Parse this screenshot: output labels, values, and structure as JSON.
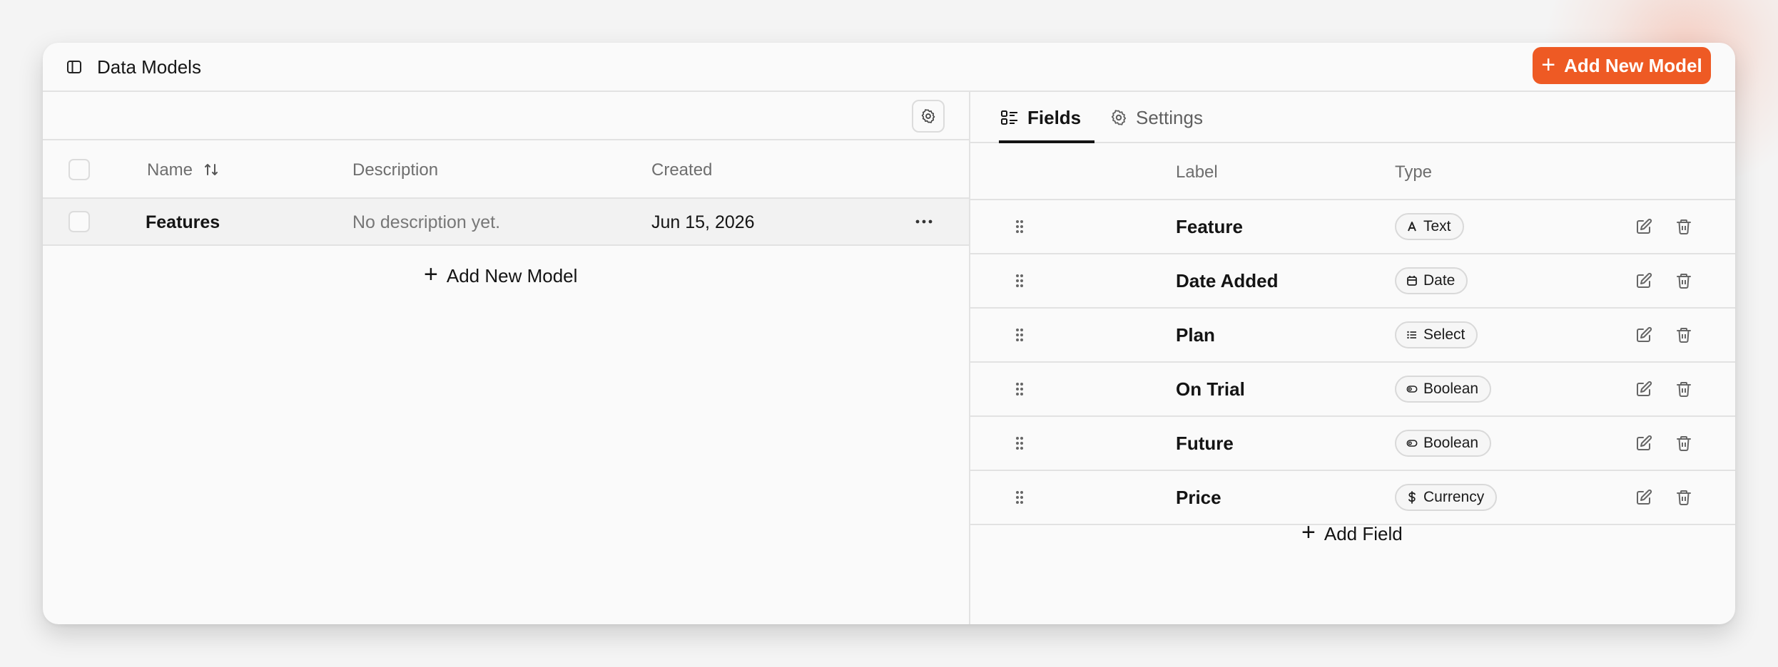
{
  "header": {
    "title": "Data Models",
    "add_button_label": "Add New Model",
    "accent_color": "#ee5a24"
  },
  "models_table": {
    "columns": {
      "name": "Name",
      "description": "Description",
      "created": "Created"
    },
    "rows": [
      {
        "name": "Features",
        "description": "No description yet.",
        "created": "Jun 15, 2026"
      }
    ],
    "add_label": "Add New Model"
  },
  "tabs": [
    {
      "label": "Fields",
      "icon": "list-icon",
      "active": true
    },
    {
      "label": "Settings",
      "icon": "gear-icon",
      "active": false
    }
  ],
  "fields_table": {
    "columns": {
      "label": "Label",
      "type": "Type"
    },
    "rows": [
      {
        "label": "Feature",
        "type": "Text",
        "icon": "text-type-icon"
      },
      {
        "label": "Date Added",
        "type": "Date",
        "icon": "calendar-icon"
      },
      {
        "label": "Plan",
        "type": "Select",
        "icon": "list-icon"
      },
      {
        "label": "On Trial",
        "type": "Boolean",
        "icon": "toggle-icon"
      },
      {
        "label": "Future",
        "type": "Boolean",
        "icon": "toggle-icon"
      },
      {
        "label": "Price",
        "type": "Currency",
        "icon": "dollar-icon"
      }
    ],
    "add_label": "Add Field"
  }
}
